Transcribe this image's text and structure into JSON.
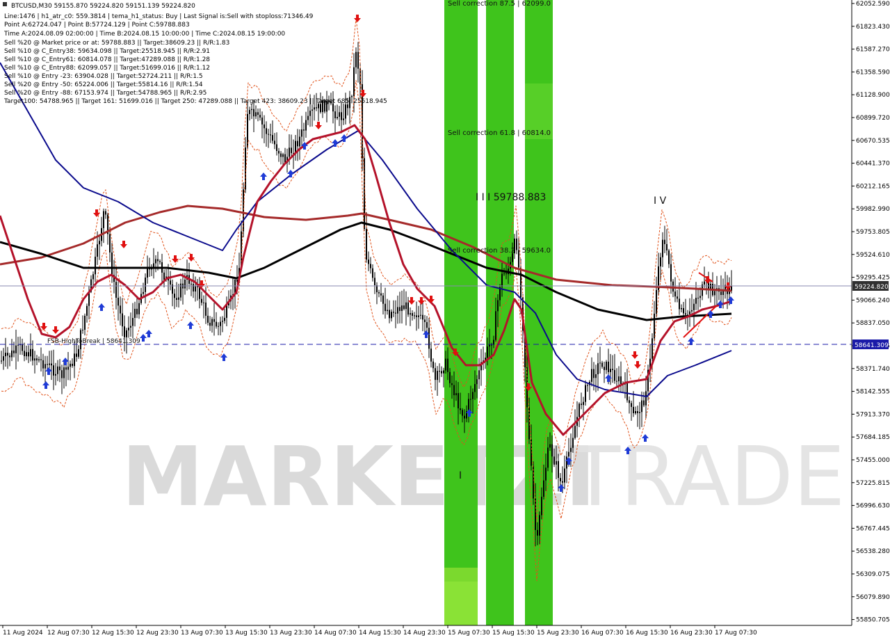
{
  "symbol_header": "BTCUSD,M30  59155.870 59224.820 59151.139 59224.820",
  "info_lines": [
    "Line:1476  |  h1_atr_c0: 559.3814  |  tema_h1_status: Buy  |  Last Signal is:Sell with stoploss:71346.49",
    "Point A:62724.047  |  Point B:57724.129  |  Point C:59788.883",
    "Time A:2024.08.09 02:00:00  |  Time B:2024.08.15 10:00:00  |  Time C:2024.08.15 19:00:00",
    "Sell %20 @ Market price or at: 59788.883  ||  Target:38609.23  ||  R/R:1.83",
    "Sell %10 @ C_Entry38: 59634.098  ||  Target:25518.945  ||  R/R:2.91",
    "Sell %10 @ C_Entry61: 60814.078  ||  Target:47289.088  ||  R/R:1.28",
    "Sell %10 @ C_Entry88: 62099.057  ||  Target:51699.016  ||  R/R:1.12",
    "Sell %10 @ Entry -23: 63904.028  ||  Target:52724.211  ||  R/R:1.5",
    "Sell %20 @ Entry -50: 65224.006  ||  Target:55814.16  ||  R/R:1.54",
    "Sell %20 @ Entry -88: 67153.974  ||  Target:54788.965  ||  R/R:2.95",
    "Target100: 54788.965  ||  Target 161: 51699.016  ||  Target 250: 47289.088  ||  Target 423: 38609.23  ||  Target 685: 25518.945"
  ],
  "price_axis": {
    "ticks": [
      "62052.590",
      "61823.430",
      "61587.270",
      "61358.590",
      "61128.900",
      "60899.720",
      "60670.535",
      "60441.370",
      "60212.165",
      "59982.990",
      "59753.805",
      "59524.610",
      "59295.425",
      "59066.240",
      "58837.050",
      "58607.855",
      "58371.740",
      "58142.555",
      "57913.370",
      "57684.185",
      "57455.000",
      "57225.815",
      "56996.630",
      "56767.445",
      "56538.280",
      "56309.075",
      "56079.890",
      "55850.705"
    ],
    "current_price_label": "59224.820",
    "fsb_price_label": "58641.309",
    "current_color": "#303030",
    "fsb_color": "#1a1aa8"
  },
  "time_axis": {
    "ticks": [
      "11 Aug 2024",
      "12 Aug 07:30",
      "12 Aug 15:30",
      "12 Aug 23:30",
      "13 Aug 07:30",
      "13 Aug 15:30",
      "13 Aug 23:30",
      "14 Aug 07:30",
      "14 Aug 15:30",
      "14 Aug 23:30",
      "15 Aug 07:30",
      "15 Aug 15:30",
      "15 Aug 23:30",
      "16 Aug 07:30",
      "16 Aug 15:30",
      "16 Aug 23:30",
      "17 Aug 07:30"
    ]
  },
  "overlay_labels": {
    "corr87": "Sell correction 87.5 | 62099.0",
    "corr61": "Sell correction 61.8 | 60814.0",
    "corr38": "Sell correction 38.2 | 59634.0",
    "wave3": "I I I 59788.883",
    "wave4": "I V",
    "wave1": "I",
    "fsb": "FSB-HighToBreak  |  58641.309"
  },
  "watermark": {
    "part1": "MARKETZI",
    "part2": "TRADE"
  },
  "colors": {
    "green_band": "#3fc41c",
    "green_light": "#7bd92e",
    "ma_black": "#000000",
    "ma_brown": "#a52a2a",
    "ma_blue": "#0a0a8c",
    "tema_red": "#b4122a",
    "arrow_up": "#1f3bd6",
    "arrow_down": "#e01010",
    "candle": "#000000"
  }
}
